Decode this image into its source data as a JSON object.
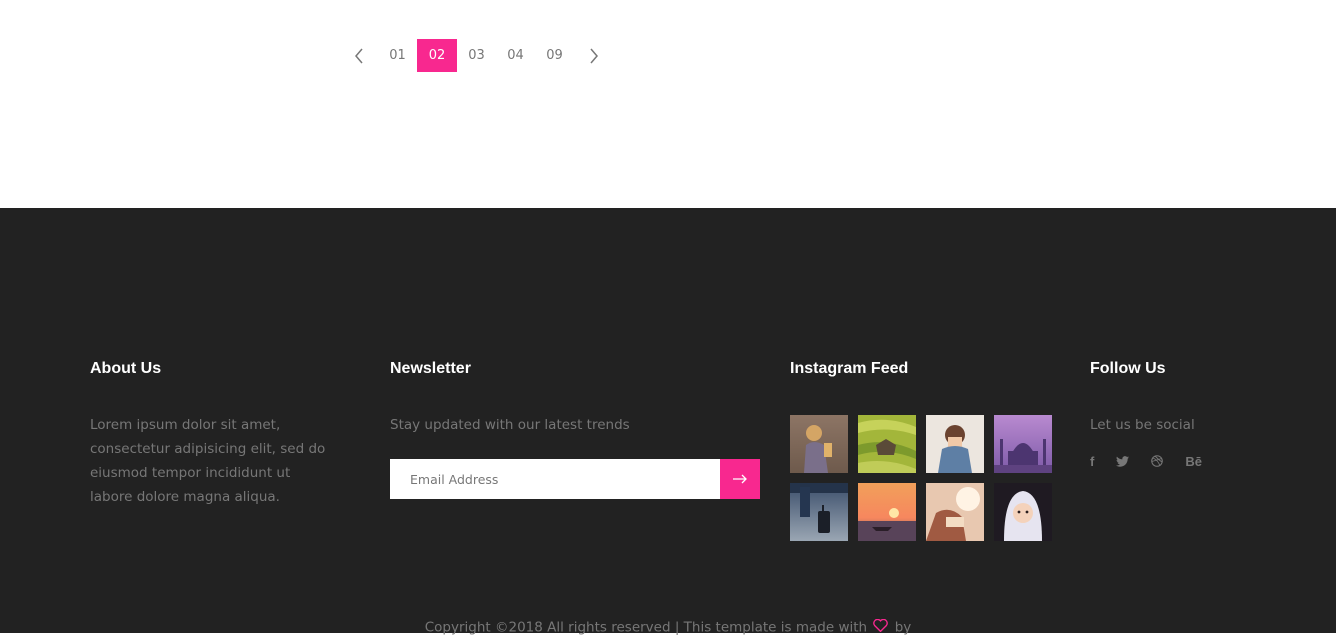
{
  "pagination": {
    "prev_icon": "chevron-left-icon",
    "next_icon": "chevron-right-icon",
    "pages": [
      "01",
      "02",
      "03",
      "04",
      "09"
    ],
    "active_page": "02",
    "active_color": "#f8288f"
  },
  "footer": {
    "background": "#222222",
    "about": {
      "title": "About Us",
      "text": "Lorem ipsum dolor sit amet, consectetur adipisicing elit, sed do eiusmod tempor incididunt ut labore dolore magna aliqua."
    },
    "newsletter": {
      "title": "Newsletter",
      "text": "Stay updated with our latest trends",
      "email_placeholder": "Email Address",
      "submit_icon": "arrow-right-icon"
    },
    "instagram": {
      "title": "Instagram Feed",
      "images": [
        "child-in-coat-thumbnail",
        "rice-terraces-thumbnail",
        "girl-in-denim-thumbnail",
        "taj-mahal-thumbnail",
        "traveler-with-suitcase-thumbnail",
        "sunset-boat-thumbnail",
        "girl-reading-thumbnail",
        "child-in-white-hood-thumbnail"
      ]
    },
    "follow": {
      "title": "Follow Us",
      "text": "Let us be social",
      "socials": [
        {
          "name": "facebook",
          "icon": "facebook-icon",
          "glyph": "f"
        },
        {
          "name": "twitter",
          "icon": "twitter-icon",
          "glyph": ""
        },
        {
          "name": "dribbble",
          "icon": "dribbble-icon",
          "glyph": ""
        },
        {
          "name": "behance",
          "icon": "behance-icon",
          "glyph": "Bē"
        }
      ]
    },
    "copyright": {
      "before": "Copyright ©2018 All rights reserved | This template is made with",
      "heart_icon": "heart-icon",
      "after": "by"
    }
  }
}
